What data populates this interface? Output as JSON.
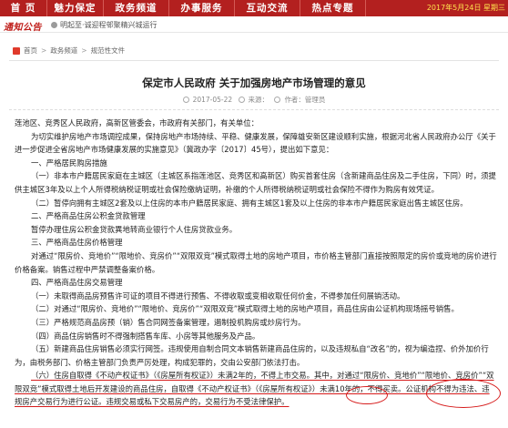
{
  "nav": {
    "items": [
      "首 页",
      "魅力保定",
      "政务频道",
      "办事服务",
      "互动交流",
      "热点专题"
    ],
    "date_prefix": "2017年5月24日",
    "date_suffix": "星期三"
  },
  "notice": {
    "logo_text": "通知公告",
    "message": "明起至·诚迎程邨聚精兴城运行"
  },
  "breadcrumb": {
    "home": "首页",
    "items": [
      "政务频道",
      "规范性文件"
    ],
    "separator": ">"
  },
  "article": {
    "title": "保定市人民政府  关于加强房地产市场管理的意见",
    "date": "2017-05-22",
    "source": "来源：",
    "author": "作者：管理员",
    "paragraphs": [
      "莲池区、竞秀区人民政府，高新区管委会，市政府有关部门，有关单位：",
      "为切实维护房地产市场调控成果，保持房地产市场持续、平稳、健康发展，保障雄安新区建设顺利实施，根据河北省人民政府办公厅《关于进一步促进全省房地产市场健康发展的实施意见》（冀政办字〔2017〕45号），提出如下意见：",
      "一、严格居民购房措施",
      "（一）非本市户籍居民家庭在主城区（主城区系指莲池区、竞秀区和高新区）购买首套住房（含新建商品住房及二手住房，下同）时，须提供主城区3年及以上个人所得税纳税证明或社会保险缴纳证明，补缴的个人所得税纳税证明或社会保险不得作为购房有效凭证。",
      "（二）暂停向拥有主城区2套及以上住房的本市户籍居民家庭、拥有主城区1套及以上住房的非本市户籍居民家庭出售主城区住房。",
      "二、严格商品住房公积金贷款管理",
      "暂停办理住房公积金贷款異地转商业银行个人住房贷款业务。",
      "三、严格商品住房价格管理",
      "对通过“限房价、竞地价”“限地价、竞房价”“双限双竞”模式取得土地的房地产项目，市价格主管部门直接按照限定的房价或竞地的房价进行价格备案。销售过程中严禁调整备案价格。",
      "四、严格商品住房交易管理",
      "（一）未取得商品房预售许可证的项目不得进行预售、不得收取或变相收取任何价金，不得参加任何展销活动。",
      "（二）对通过“限房价、竞地价”“限地价、竞房价”“双限双竞”模式取得土地的房地产项目，商品住房由公证机构现场摇号销售。",
      "（三）严格规范商品房预（销）售合同网签备案管理，遏制投机购房或炒房行为。",
      "（四）商品住房销售时不得强制搭售车库、小房等其他服务及产品。",
      "（五）新建商品住房销售必须实行网签。违规使用自制合同文本销售新建商品住房的，以及违规私自“改名”的，视为编造捏、价外加价行为，由税务部门、价格主管部门负责严厉处理，构成犯罪的，交由公安部门依法打击。",
      "（六）住房自取得《不动产权证书》（《房屋所有权证》）未满2年的，不得上市交易。其中，对通过“限房价、竞地价”“限地价、竞房价”“双限双竞”模式取得土地后开发建设的商品住房，自取得《不动产权证书》（《房屋所有权证》）未满10年的，不得买卖。公证机构不得为违法、违规房产交易行为进行公证。违规交易或私下交易房产的，交易行为不受法律保护。"
    ]
  }
}
